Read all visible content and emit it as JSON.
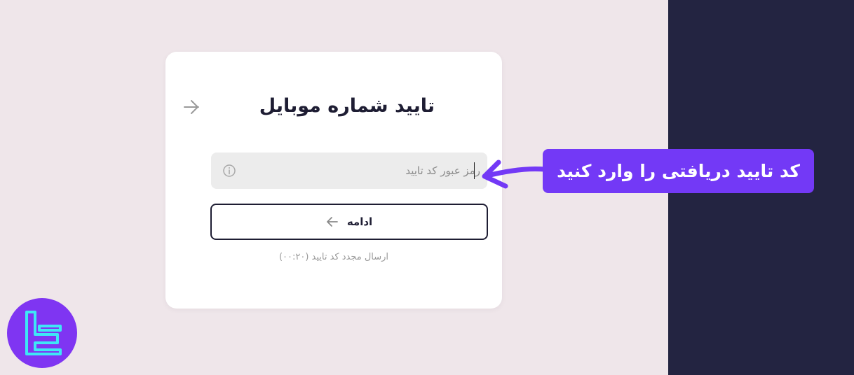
{
  "card": {
    "title": "تایید شماره موبایل",
    "code_input": {
      "placeholder": "رمز عبور کد تایید",
      "value": ""
    },
    "continue_label": "ادامه",
    "resend_text": "ارسال مجدد کد تایید (۰۰:۲۰)"
  },
  "annotation": {
    "text": "کد تایید دریافتی را وارد کنید"
  },
  "icons": {
    "back": "arrow-right-icon",
    "info": "info-icon",
    "button_arrow": "arrow-left-icon"
  },
  "colors": {
    "background": "#efe6ea",
    "side_panel": "#232441",
    "card": "#ffffff",
    "input_bg": "#ececec",
    "text_dark": "#1e1d33",
    "accent_purple": "#7339f6",
    "logo_purple": "#7f35f2",
    "logo_cyan": "#3ee7f6"
  }
}
